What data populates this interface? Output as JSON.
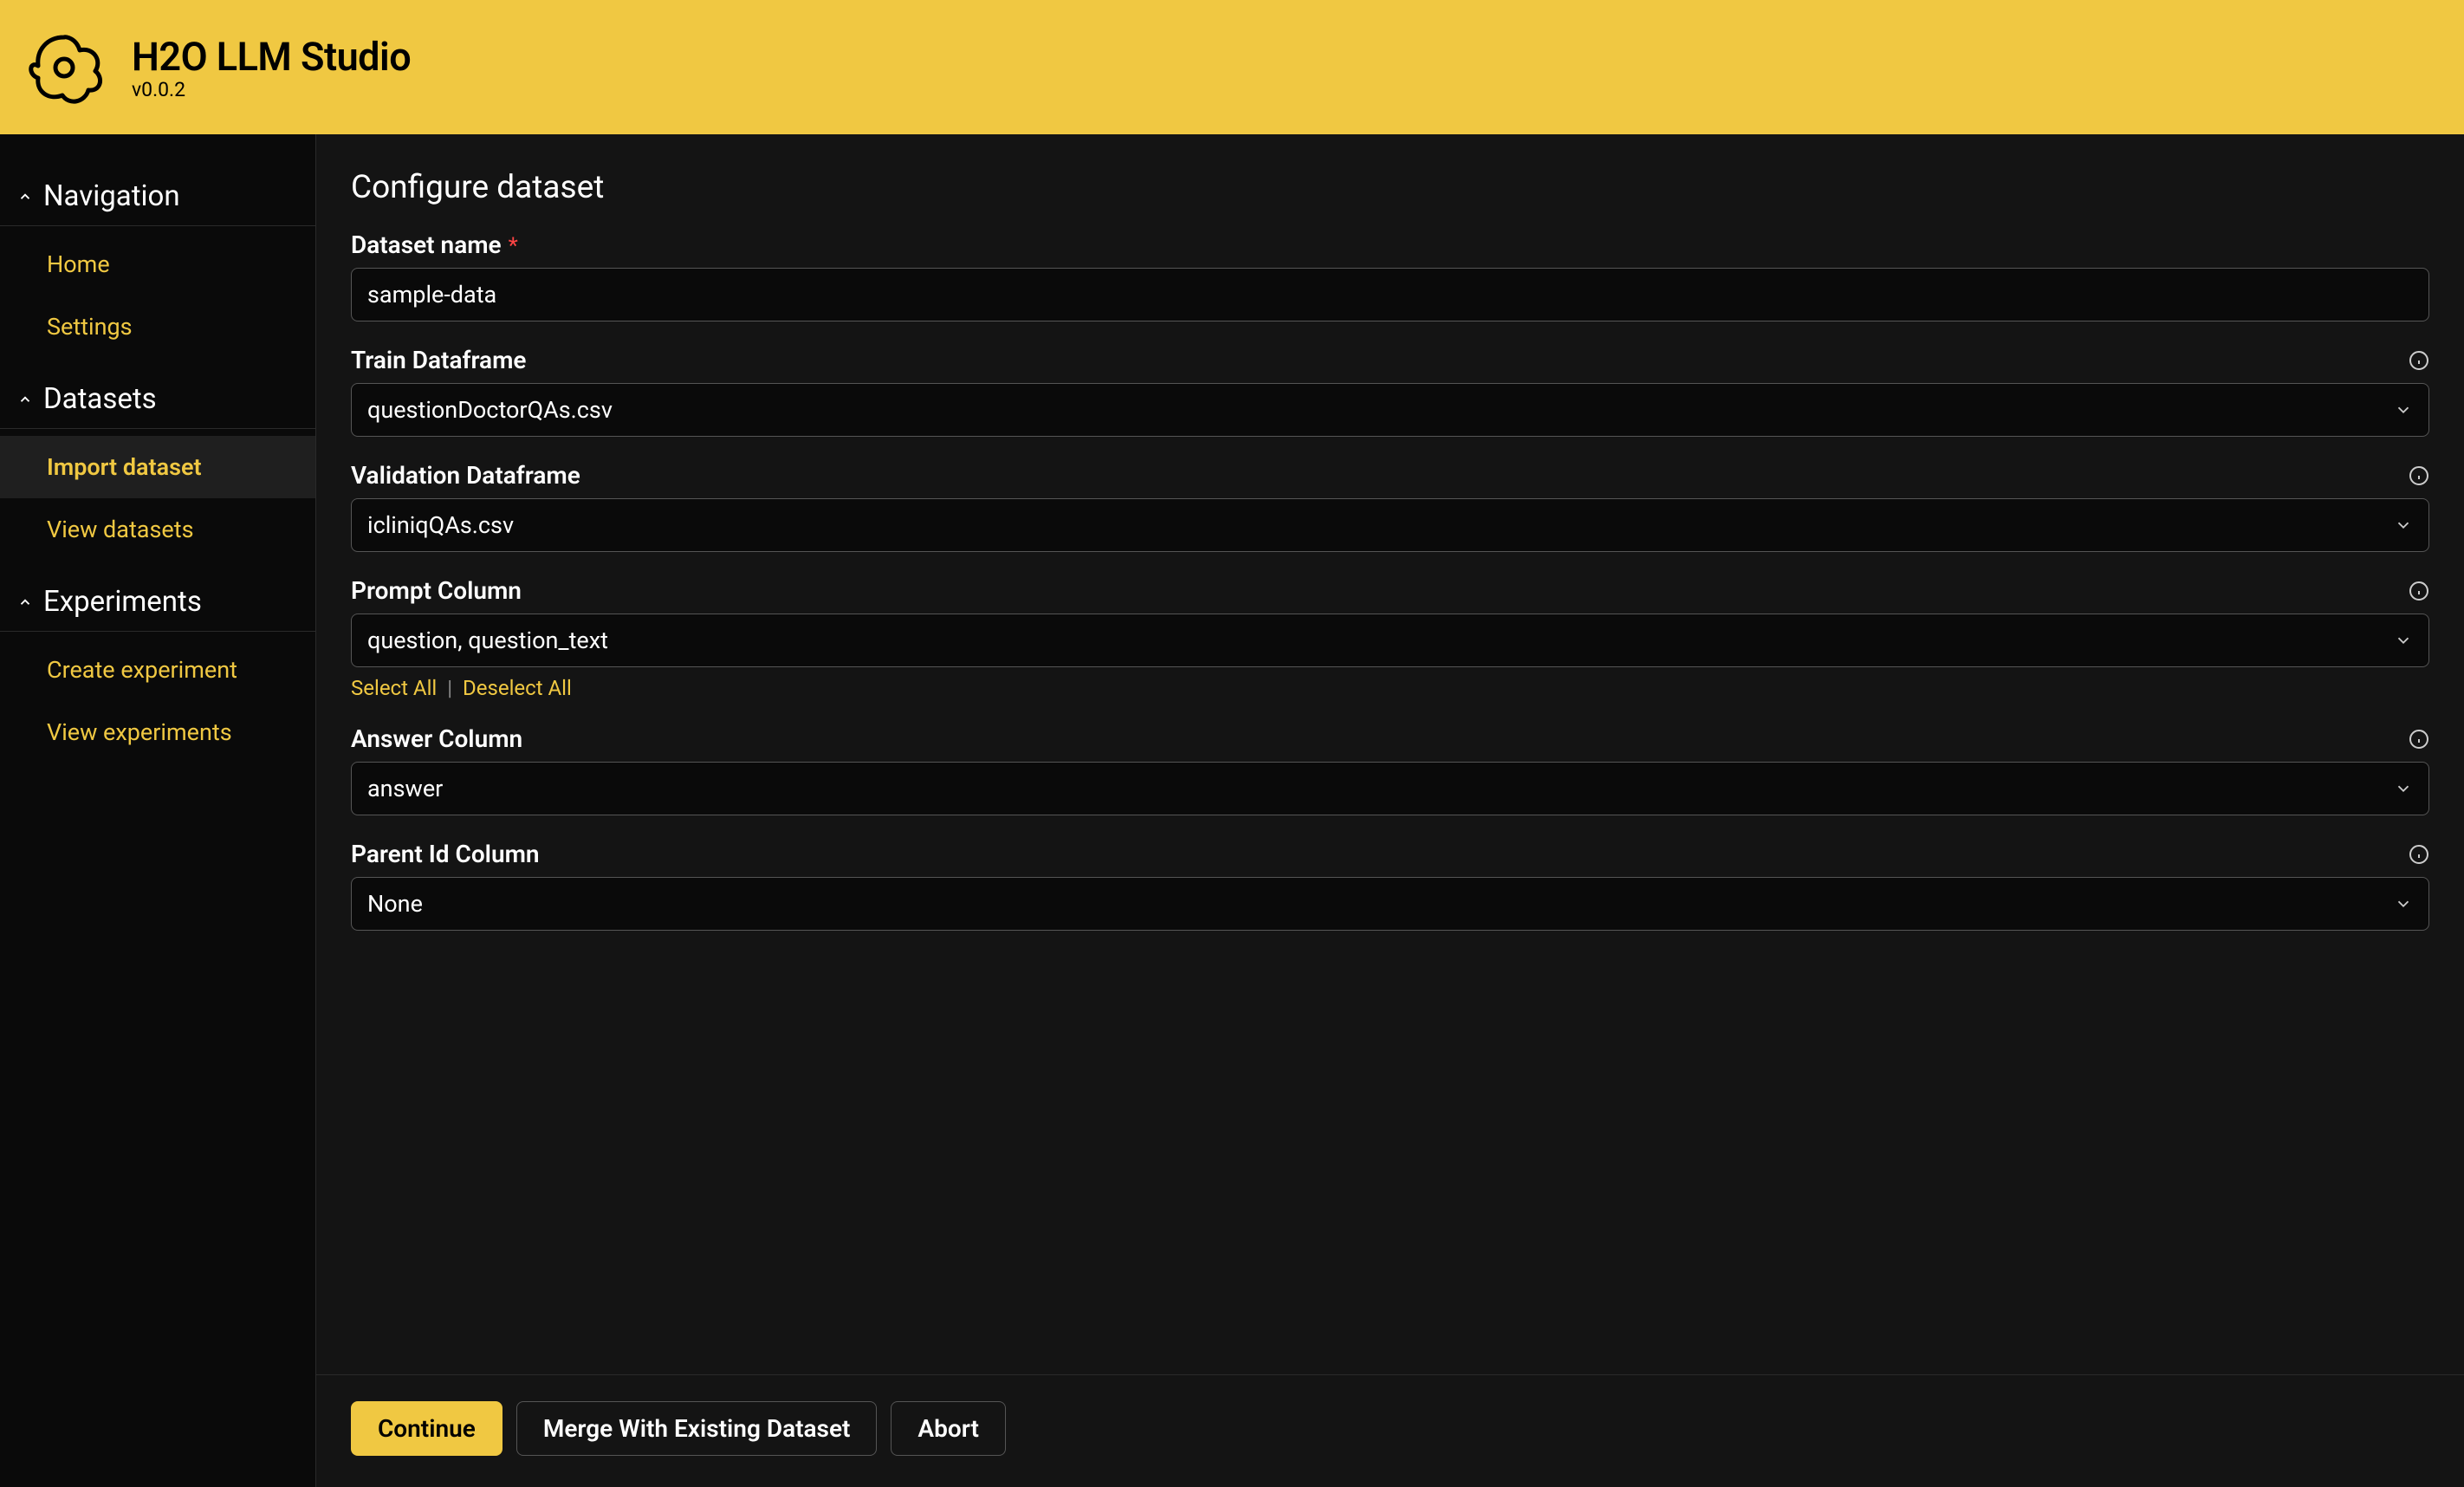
{
  "header": {
    "app_title": "H2O LLM Studio",
    "app_version": "v0.0.2"
  },
  "sidebar": {
    "sections": [
      {
        "title": "Navigation",
        "items": [
          {
            "label": "Home",
            "active": false
          },
          {
            "label": "Settings",
            "active": false
          }
        ]
      },
      {
        "title": "Datasets",
        "items": [
          {
            "label": "Import dataset",
            "active": true
          },
          {
            "label": "View datasets",
            "active": false
          }
        ]
      },
      {
        "title": "Experiments",
        "items": [
          {
            "label": "Create experiment",
            "active": false
          },
          {
            "label": "View experiments",
            "active": false
          }
        ]
      }
    ]
  },
  "content": {
    "page_title": "Configure dataset",
    "fields": {
      "dataset_name": {
        "label": "Dataset name",
        "value": "sample-data",
        "required": true
      },
      "train_dataframe": {
        "label": "Train Dataframe",
        "value": "questionDoctorQAs.csv"
      },
      "validation_dataframe": {
        "label": "Validation Dataframe",
        "value": "icliniqQAs.csv"
      },
      "prompt_column": {
        "label": "Prompt Column",
        "value": "question, question_text",
        "select_all": "Select All",
        "deselect_all": "Deselect All"
      },
      "answer_column": {
        "label": "Answer Column",
        "value": "answer"
      },
      "parent_id_column": {
        "label": "Parent Id Column",
        "value": "None"
      }
    }
  },
  "footer": {
    "continue": "Continue",
    "merge": "Merge With Existing Dataset",
    "abort": "Abort"
  }
}
